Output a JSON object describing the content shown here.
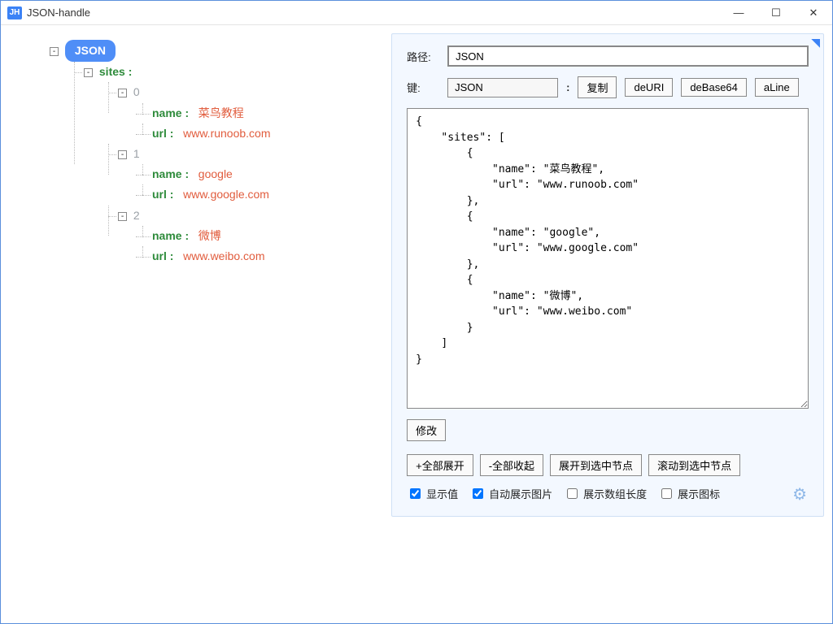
{
  "window": {
    "title": "JSON-handle",
    "icon_text": "JH"
  },
  "winbtns": {
    "min": "—",
    "max": "☐",
    "close": "✕"
  },
  "tree": {
    "root_label": "JSON",
    "sites_key": "sites :",
    "items": [
      {
        "idx": "0",
        "name_key": "name :",
        "name_val": "菜鸟教程",
        "url_key": "url :",
        "url_val": "www.runoob.com"
      },
      {
        "idx": "1",
        "name_key": "name :",
        "name_val": "google",
        "url_key": "url :",
        "url_val": "www.google.com"
      },
      {
        "idx": "2",
        "name_key": "name :",
        "name_val": "微博",
        "url_key": "url :",
        "url_val": "www.weibo.com"
      }
    ]
  },
  "panel": {
    "path_label": "路径:",
    "path_value": "JSON",
    "key_label": "键:",
    "key_value": "JSON",
    "btn_copy": "复制",
    "btn_deURI": "deURI",
    "btn_deBase64": "deBase64",
    "btn_aLine": "aLine",
    "json_text": "{\n    \"sites\": [\n        {\n            \"name\": \"菜鸟教程\",\n            \"url\": \"www.runoob.com\"\n        },\n        {\n            \"name\": \"google\",\n            \"url\": \"www.google.com\"\n        },\n        {\n            \"name\": \"微博\",\n            \"url\": \"www.weibo.com\"\n        }\n    ]\n}",
    "btn_modify": "修改",
    "btn_expand_all": "+全部展开",
    "btn_collapse_all": "-全部收起",
    "btn_expand_to_sel": "展开到选中节点",
    "btn_scroll_to_sel": "滚动到选中节点",
    "chk_show_value": "显示值",
    "chk_auto_img": "自动展示图片",
    "chk_array_len": "展示数组长度",
    "chk_show_icon": "展示图标"
  }
}
